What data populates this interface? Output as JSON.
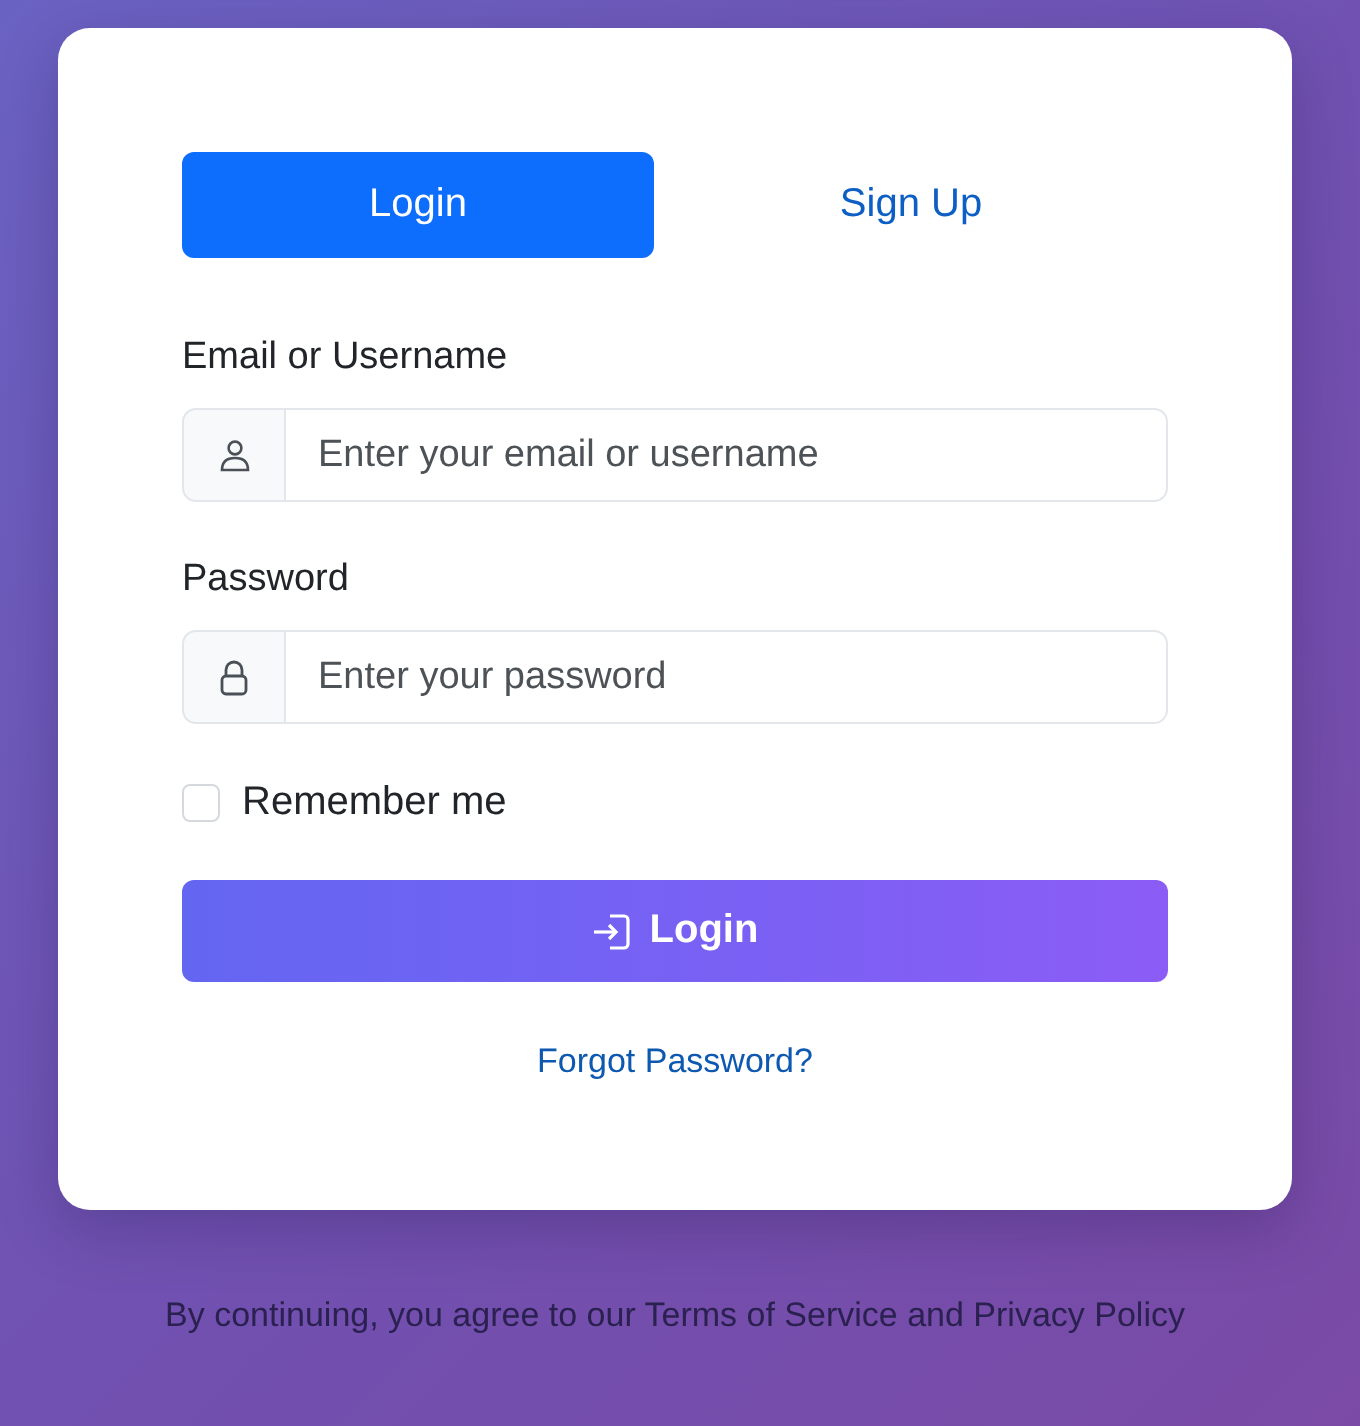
{
  "tabs": [
    {
      "label": "Login",
      "selected": true
    },
    {
      "label": "Sign Up",
      "selected": false
    }
  ],
  "fields": [
    {
      "label": "Email or Username",
      "placeholder": "Enter your email or username",
      "kind": "text"
    },
    {
      "label": "Password",
      "placeholder": "Enter your password",
      "kind": "password"
    }
  ],
  "remember": {
    "label": "Remember me",
    "checked": false
  },
  "submit": {
    "label": "Login"
  },
  "forgot_link": "Forgot Password?",
  "footer": "By continuing, you agree to our Terms of Service and Privacy Policy"
}
